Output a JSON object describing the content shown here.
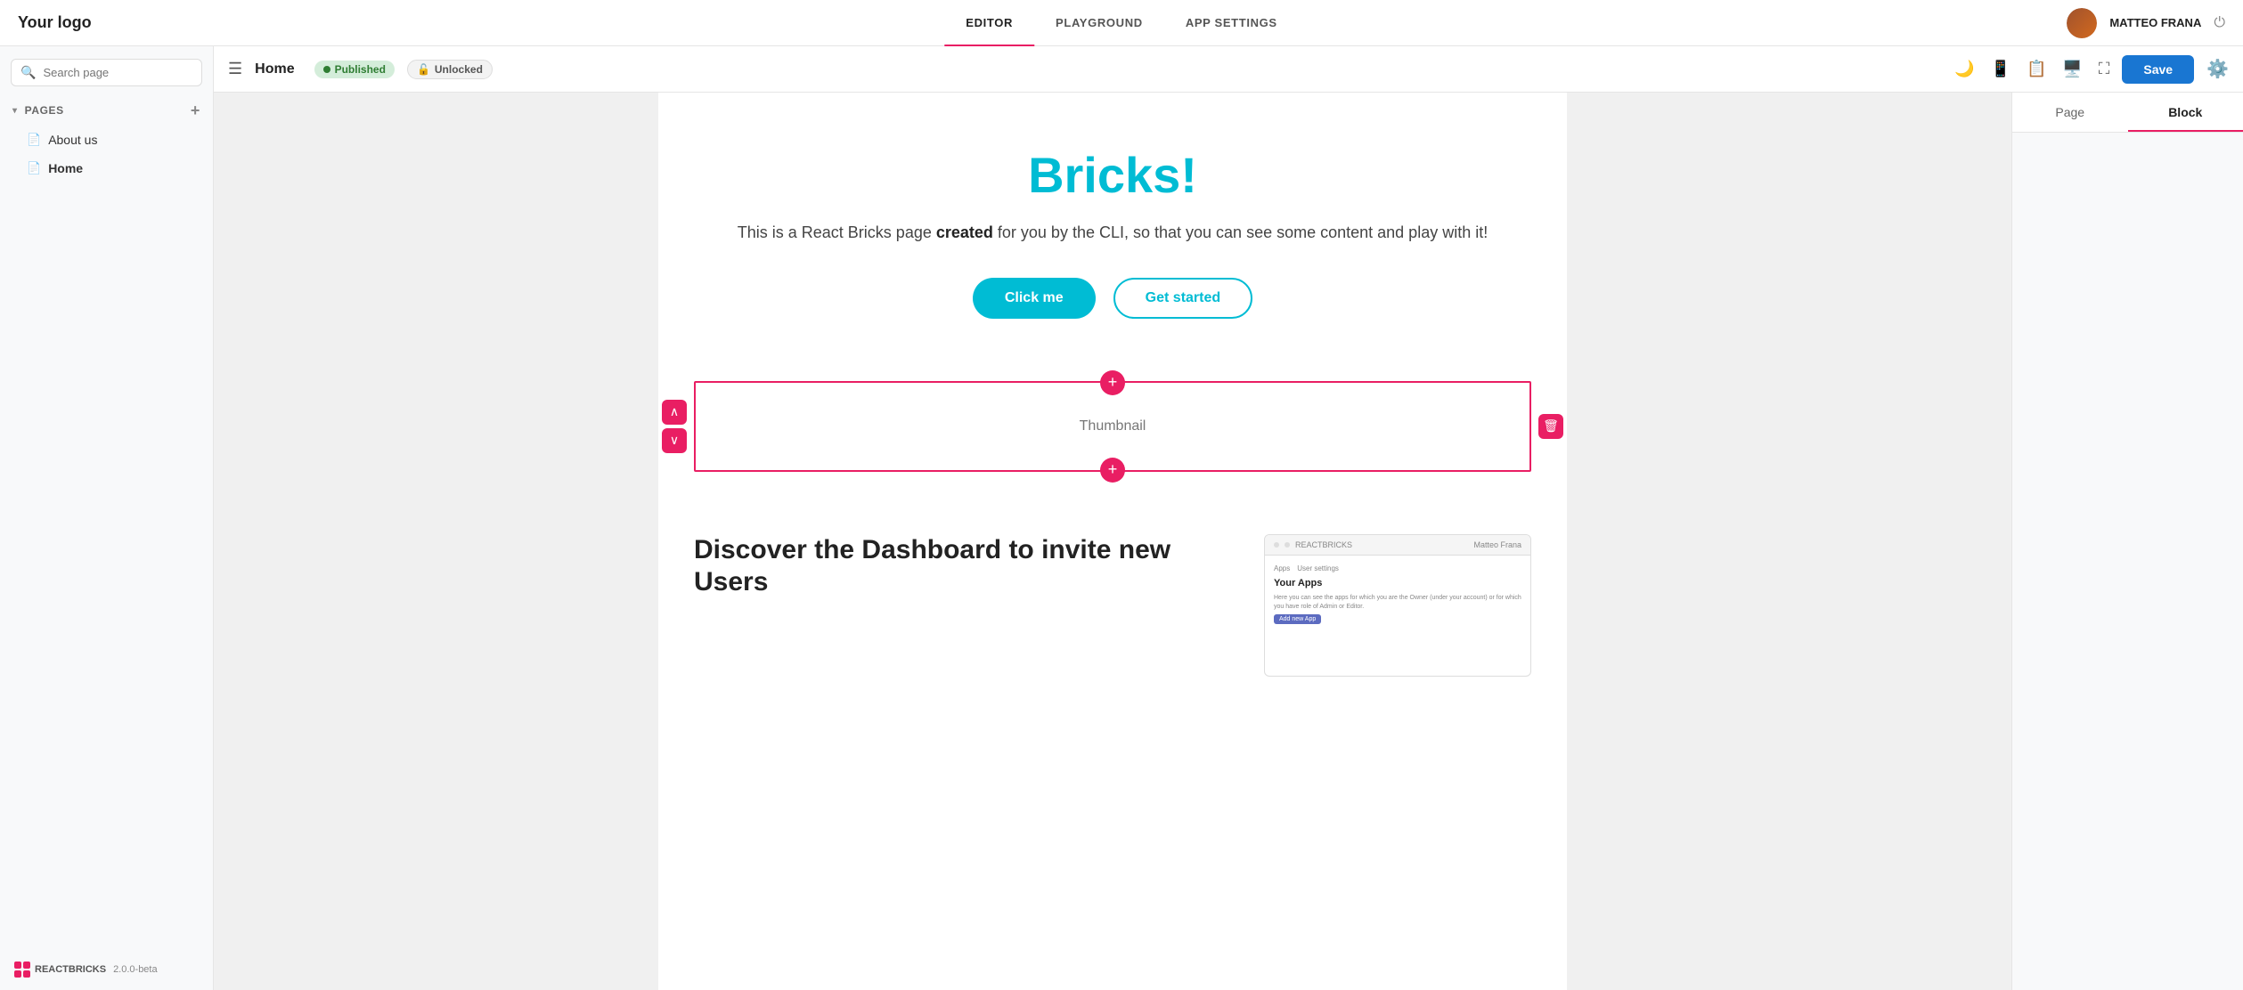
{
  "app": {
    "logo": "Your logo",
    "nav_tabs": [
      {
        "id": "editor",
        "label": "EDITOR",
        "active": true
      },
      {
        "id": "playground",
        "label": "PLAYGROUND",
        "active": false
      },
      {
        "id": "app-settings",
        "label": "APP SETTINGS",
        "active": false
      }
    ],
    "user_name": "MATTEO FRANA",
    "version": "2.0.0-beta"
  },
  "sidebar": {
    "search_placeholder": "Search page",
    "pages_section_label": "PAGES",
    "pages": [
      {
        "id": "about-us",
        "label": "About us",
        "active": false
      },
      {
        "id": "home",
        "label": "Home",
        "active": true
      }
    ]
  },
  "editor_toolbar": {
    "page_name": "Home",
    "status_published": "Published",
    "status_unlocked": "Unlocked",
    "save_label": "Save"
  },
  "canvas": {
    "hero_title": "Bricks!",
    "hero_subtitle_text": "This is a React Bricks page created for you by the CLI, so that you can see some content and play with it!",
    "btn_click_me": "Click me",
    "btn_get_started": "Get started",
    "thumbnail_label": "Thumbnail",
    "discover_title": "Discover the Dashboard to invite new Users",
    "mock_header_left": "REACTBRICKS",
    "mock_header_right": "Matteo Frana",
    "mock_nav_1": "Apps",
    "mock_nav_2": "User settings",
    "mock_your_apps": "Your Apps",
    "mock_desc": "Here you can see the apps for which you are the Owner (under your account) or for which you have role of Admin or Editor.",
    "mock_btn": "Add new App"
  },
  "right_panel": {
    "tab_page": "Page",
    "tab_block": "Block"
  }
}
